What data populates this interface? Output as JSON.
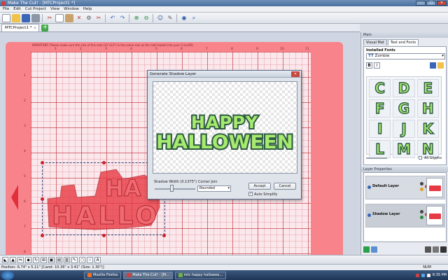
{
  "window": {
    "title": "Make The Cut! - [MTCProject1 *]",
    "controls": [
      "–",
      "□",
      "✕"
    ]
  },
  "menu": [
    "File",
    "Edit",
    "Cut Project",
    "View",
    "Window",
    "Help"
  ],
  "toolbar": {
    "icons": [
      "new-icon",
      "open-icon",
      "save-icon",
      "print-icon",
      "cut-icon",
      "copy-icon",
      "paste-icon",
      "delete-icon",
      "settings-icon",
      "scissors-icon",
      "undo-icon",
      "redo-icon",
      "zoom-in-icon",
      "zoom-out-icon",
      "user-icon",
      "pen-icon",
      "globe-icon",
      "search-icon"
    ]
  },
  "tabs": {
    "active": "MTCProject1 *",
    "close": "x",
    "add": "+"
  },
  "mat": {
    "notice": "IMPORTANT: Please make sure the size of this mat (12\"x12\") is the same size as the mat loaded into your Cricut(R)",
    "ruler_top": [
      "1",
      "2",
      "3",
      "4",
      "5",
      "6",
      "7",
      "8",
      "9",
      "10",
      "11"
    ],
    "ruler_left": [
      "1",
      "2",
      "3",
      "4",
      "5",
      "6",
      "7",
      "8"
    ]
  },
  "dialog": {
    "title": "Generate Shadow Layer",
    "close": "✕",
    "preview_line1": "HAPPY",
    "preview_line2": "HALLOWEEN",
    "shadow_width_label": "Shadow Width (0.1375\")",
    "corner_join_label": "Corner Join",
    "corner_join_value": "Rounded",
    "accept": "Accept",
    "cancel": "Cancel",
    "auto_simplify_label": "Auto Simplify",
    "auto_simplify_checked": true,
    "shadow_width_level": 0.42
  },
  "right_panel": {
    "header": "Main",
    "tabs": [
      "Visual Mat",
      "Text and Fonts"
    ],
    "active_tab": "Text and Fonts",
    "installed_fonts_label": "Installed Fonts",
    "font": "Zombie",
    "bold": "B",
    "italic": "I",
    "glyphs": [
      "C",
      "D",
      "E",
      "F",
      "G",
      "H",
      "I",
      "J",
      "K",
      "L",
      "M",
      "N"
    ],
    "all_glyphs_label": "All Glyphs",
    "layer_header": "Layer Properties",
    "layers": [
      "Default Layer",
      "Shadow Layer"
    ]
  },
  "status": {
    "position": "Position: 6.74\" x 5.11\" [Caret: 10.36\" x 3.41\" (Size: 1.30\")]",
    "num": "NUM"
  },
  "taskbar": {
    "tasks": [
      "Mozilla Firefox",
      "Make The Cut! - [M...",
      "mtc happy hallowee..."
    ],
    "active_task": 1,
    "clock": "6:35 PM"
  },
  "colors": {
    "mat": "#f8838a",
    "shape": "#e8363f",
    "glyph_fill": "#a6ea6e",
    "glyph_stroke": "#2e5a44",
    "shadow": "#2e5a44"
  }
}
